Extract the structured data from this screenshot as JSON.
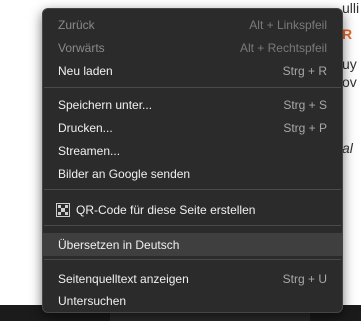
{
  "background": {
    "lines": [
      {
        "text": "ulli",
        "style": "normal"
      },
      {
        "text": "R",
        "style": "orange"
      },
      {
        "text": "uy",
        "style": "normal"
      },
      {
        "text": "ov",
        "style": "normal"
      },
      {
        "text": "al",
        "style": "italic"
      }
    ]
  },
  "menu": {
    "items": [
      {
        "label": "Zurück",
        "shortcut": "Alt + Linkspfeil",
        "disabled": true
      },
      {
        "label": "Vorwärts",
        "shortcut": "Alt + Rechtspfeil",
        "disabled": true
      },
      {
        "label": "Neu laden",
        "shortcut": "Strg + R"
      },
      {
        "label": "Speichern unter...",
        "shortcut": "Strg + S"
      },
      {
        "label": "Drucken...",
        "shortcut": "Strg + P"
      },
      {
        "label": "Streamen..."
      },
      {
        "label": "Bilder an Google senden"
      },
      {
        "label": "QR-Code für diese Seite erstellen",
        "icon": "qr-code-icon"
      },
      {
        "label": "Übersetzen in Deutsch",
        "highlighted": true
      },
      {
        "label": "Seitenquelltext anzeigen",
        "shortcut": "Strg + U"
      },
      {
        "label": "Untersuchen"
      }
    ]
  },
  "colors": {
    "menu_background": "#2b2b2b",
    "highlight": "#3f3f3f",
    "accent_orange": "#e8692a"
  }
}
